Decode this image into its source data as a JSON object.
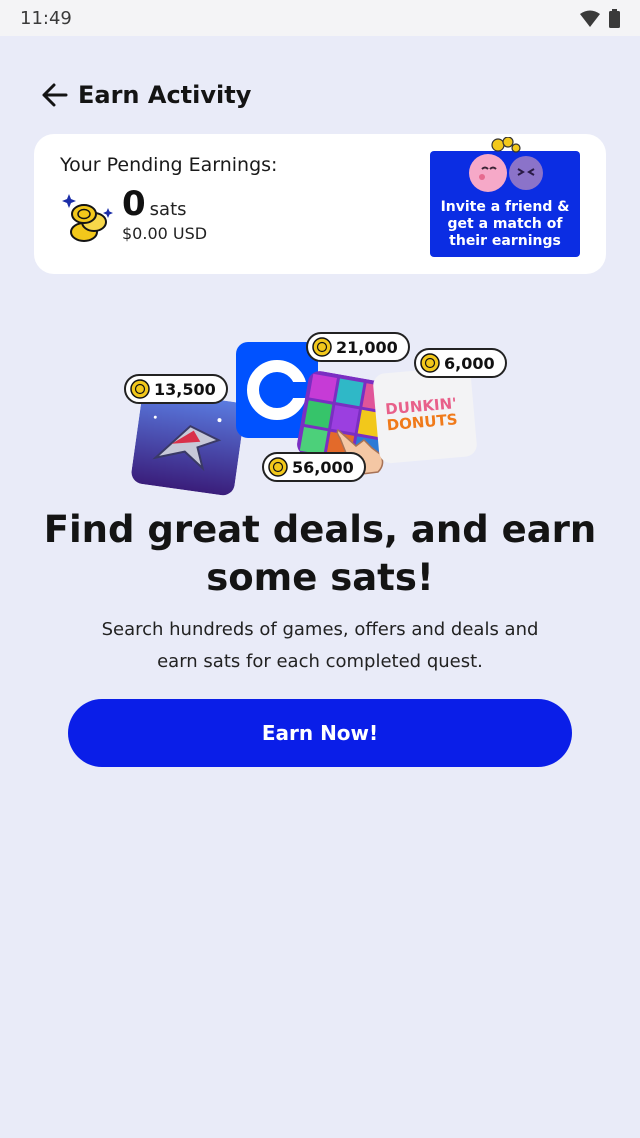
{
  "status_bar": {
    "time": "11:49",
    "icons": [
      "wifi-icon",
      "battery-icon"
    ]
  },
  "header": {
    "back_icon": "arrow-left-icon",
    "title": "Earn Activity"
  },
  "earnings_card": {
    "label": "Your Pending Earnings:",
    "sats_value": "0",
    "sats_unit": "sats",
    "usd_value": "$0.00 USD",
    "invite": {
      "text": "Invite a friend &\nget a match of\ntheir earnings"
    }
  },
  "hero": {
    "offers": [
      {
        "name": "space-shooter-game",
        "reward": "13,500"
      },
      {
        "name": "coinbase",
        "reward": "21,000"
      },
      {
        "name": "block-puzzle-game",
        "reward": "56,000"
      },
      {
        "name": "dunkin-donuts",
        "reward": "6,000"
      }
    ],
    "dunkin_logo_text": [
      "DUNKIN'",
      "DONUTS"
    ]
  },
  "headline": "Find great deals, and earn\nsome sats!",
  "subtext": "Search hundreds of games, offers and deals and\nearn sats for each completed quest.",
  "cta": {
    "label": "Earn Now!"
  },
  "colors": {
    "background": "#e9ebf8",
    "brand_blue": "#0a1ee8",
    "invite_blue": "#0b2de3",
    "coinbase_blue": "#0052ff",
    "coin_gold": "#f2c81b"
  }
}
